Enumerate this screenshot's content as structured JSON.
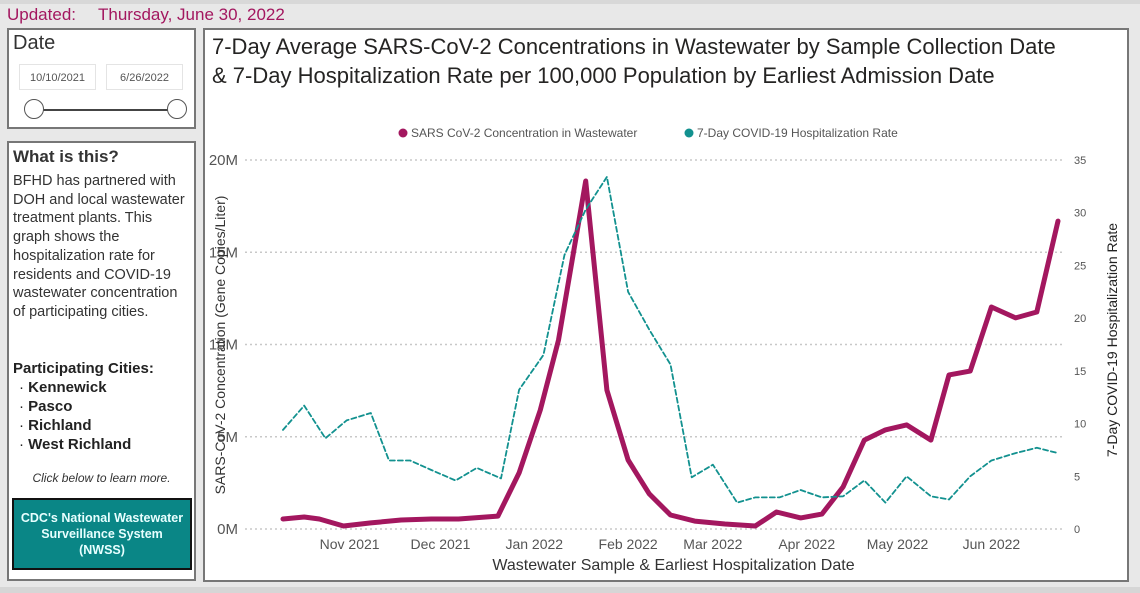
{
  "header": {
    "updated_label": "Updated:",
    "updated_date": "Thursday, June 30, 2022"
  },
  "date_filter": {
    "title": "Date",
    "start": "10/10/2021",
    "end": "6/26/2022"
  },
  "info": {
    "heading": "What is this?",
    "body": "BFHD has partnered with DOH and local wastewater treatment plants. This graph shows the hospitalization rate for residents and COVID-19 wastewater concentration of participating cities.",
    "cities_heading": "Participating Cities:",
    "cities": [
      "Kennewick",
      "Pasco",
      "Richland",
      "West Richland"
    ],
    "learn_more": "Click below to learn more.",
    "button_label": "CDC's National Wastewater Surveillance System (NWSS)"
  },
  "chart_data": {
    "type": "line",
    "title": "7-Day Average SARS-CoV-2 Concentrations in Wastewater by Sample Collection Date & 7-Day Hospitalization Rate per 100,000 Population by Earliest Admission Date",
    "xlabel": "Wastewater Sample & Earliest Hospitalization Date",
    "ylabel": "SARS-CoV-2 Concentration (Gene Copies/Liter)",
    "y2label": "7-Day COVID-19 Hospitalization Rate",
    "xlim": [
      "2021-10-10",
      "2022-06-23"
    ],
    "x_ticks": [
      {
        "date": "2021-11-01",
        "label": "Nov 2021"
      },
      {
        "date": "2021-12-01",
        "label": "Dec 2021"
      },
      {
        "date": "2022-01-01",
        "label": "Jan 2022"
      },
      {
        "date": "2022-02-01",
        "label": "Feb 2022"
      },
      {
        "date": "2022-03-01",
        "label": "Mar 2022"
      },
      {
        "date": "2022-04-01",
        "label": "Apr 2022"
      },
      {
        "date": "2022-05-01",
        "label": "May 2022"
      },
      {
        "date": "2022-06-01",
        "label": "Jun 2022"
      }
    ],
    "ylim": [
      0,
      20000000
    ],
    "y_ticks": [
      {
        "v": 0,
        "label": "0M"
      },
      {
        "v": 5000000,
        "label": "5M"
      },
      {
        "v": 10000000,
        "label": "10M"
      },
      {
        "v": 15000000,
        "label": "15M"
      },
      {
        "v": 20000000,
        "label": "20M"
      }
    ],
    "y2lim": [
      0,
      35
    ],
    "y2_ticks": [
      {
        "v": 0,
        "label": "0"
      },
      {
        "v": 5,
        "label": "5"
      },
      {
        "v": 10,
        "label": "10"
      },
      {
        "v": 15,
        "label": "15"
      },
      {
        "v": 20,
        "label": "20"
      },
      {
        "v": 25,
        "label": "25"
      },
      {
        "v": 30,
        "label": "30"
      },
      {
        "v": 35,
        "label": "35"
      }
    ],
    "grid": true,
    "legend_position": "top",
    "series": [
      {
        "name": "SARS CoV-2 Concentration in Wastewater",
        "axis": "left",
        "color": "#a3175f",
        "style": "solid",
        "x": [
          "2021-10-10",
          "2021-10-17",
          "2021-10-22",
          "2021-10-30",
          "2021-11-08",
          "2021-11-18",
          "2021-11-28",
          "2021-12-07",
          "2021-12-20",
          "2021-12-27",
          "2022-01-03",
          "2022-01-09",
          "2022-01-18",
          "2022-01-25",
          "2022-02-01",
          "2022-02-08",
          "2022-02-15",
          "2022-02-23",
          "2022-03-05",
          "2022-03-15",
          "2022-03-22",
          "2022-03-30",
          "2022-04-06",
          "2022-04-13",
          "2022-04-20",
          "2022-04-27",
          "2022-05-04",
          "2022-05-12",
          "2022-05-18",
          "2022-05-25",
          "2022-06-01",
          "2022-06-09",
          "2022-06-16",
          "2022-06-23"
        ],
        "y": [
          540000,
          650000,
          540000,
          160000,
          330000,
          490000,
          540000,
          540000,
          700000,
          3040000,
          6450000,
          10240000,
          18860000,
          7530000,
          3740000,
          1900000,
          760000,
          430000,
          270000,
          160000,
          920000,
          600000,
          810000,
          2280000,
          4820000,
          5370000,
          5640000,
          4820000,
          8350000,
          8560000,
          12030000,
          11440000,
          11760000,
          16690000
        ]
      },
      {
        "name": "7-Day COVID-19 Hospitalization Rate",
        "axis": "right",
        "color": "#12918f",
        "style": "dashed",
        "x": [
          "2021-10-10",
          "2021-10-17",
          "2021-10-24",
          "2021-10-31",
          "2021-11-08",
          "2021-11-14",
          "2021-11-21",
          "2021-11-28",
          "2021-12-06",
          "2021-12-13",
          "2021-12-21",
          "2021-12-27",
          "2022-01-04",
          "2022-01-11",
          "2022-01-18",
          "2022-01-25",
          "2022-02-01",
          "2022-02-08",
          "2022-02-15",
          "2022-02-22",
          "2022-03-01",
          "2022-03-09",
          "2022-03-15",
          "2022-03-23",
          "2022-03-30",
          "2022-04-06",
          "2022-04-13",
          "2022-04-20",
          "2022-04-27",
          "2022-05-04",
          "2022-05-12",
          "2022-05-18",
          "2022-05-25",
          "2022-06-01",
          "2022-06-09",
          "2022-06-16",
          "2022-06-23"
        ],
        "y": [
          9.4,
          11.7,
          8.6,
          10.3,
          11.0,
          6.5,
          6.5,
          5.6,
          4.6,
          5.8,
          4.8,
          13.2,
          16.5,
          26.0,
          30.3,
          33.4,
          22.5,
          18.9,
          15.6,
          4.9,
          6.1,
          2.5,
          3.0,
          3.0,
          3.7,
          3.0,
          3.1,
          4.6,
          2.5,
          5.0,
          3.1,
          2.8,
          5.0,
          6.5,
          7.2,
          7.7,
          7.2
        ]
      }
    ]
  }
}
